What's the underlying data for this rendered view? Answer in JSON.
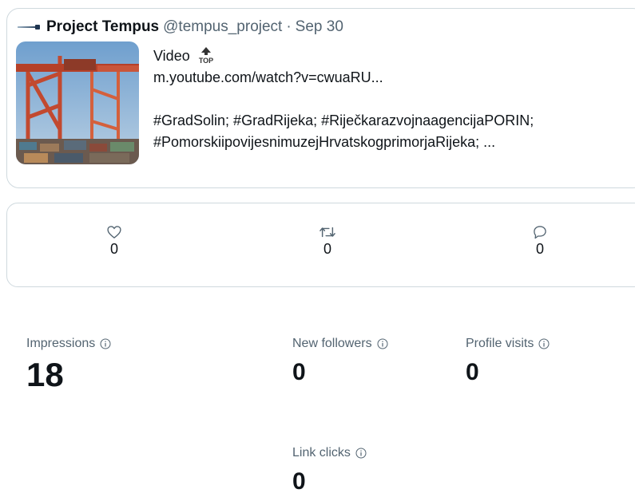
{
  "tweet": {
    "author_name": "Project Tempus",
    "author_handle": "@tempus_project",
    "separator": "·",
    "date": "Sep 30",
    "lines": [
      "Video",
      "m.youtube.com/watch?v=cwuaRU...",
      "#GradSolin; #GradRijeka; #RiječkarazvojnaagencijaPORIN;",
      "#PomorskiipovijesnimuzejHrvatskogprimorjaRijeka; ..."
    ],
    "badge_text": "TOP"
  },
  "engagement": {
    "likes": "0",
    "retweets": "0",
    "replies": "0"
  },
  "metrics": {
    "impressions": {
      "label": "Impressions",
      "value": "18"
    },
    "new_followers": {
      "label": "New followers",
      "value": "0"
    },
    "profile_visits": {
      "label": "Profile visits",
      "value": "0"
    },
    "link_clicks": {
      "label": "Link clicks",
      "value": "0"
    }
  }
}
